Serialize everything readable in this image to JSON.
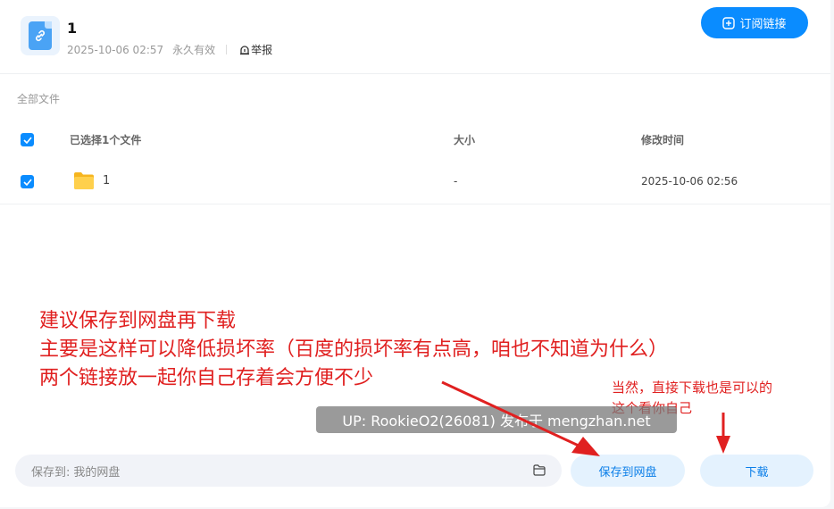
{
  "header": {
    "title": "1",
    "date": "2025-10-06 02:57",
    "validity": "永久有效",
    "report_label": "举报",
    "subscribe_label": "订阅链接"
  },
  "breadcrumb": "全部文件",
  "table": {
    "headers": {
      "name": "已选择1个文件",
      "size": "大小",
      "modified": "修改时间"
    },
    "rows": [
      {
        "name": "1",
        "size": "-",
        "modified": "2025-10-06 02:56",
        "checked": true,
        "icon": "folder-icon"
      }
    ]
  },
  "annotations": {
    "lines": [
      "建议保存到网盘再下载",
      "主要是这样可以降低损坏率（百度的损坏率有点高，咱也不知道为什么）",
      "两个链接放一起你自己存着会方便不少"
    ],
    "side_lines": [
      "当然，直接下载也是可以的",
      "这个看你自己"
    ],
    "color": "#e02020"
  },
  "watermark": "UP: RookieO2(26081) 发布于 mengzhan.net",
  "bottom": {
    "save_prefix": "保存到:",
    "save_location": "我的网盘",
    "save_button": "保存到网盘",
    "download_button": "下载"
  },
  "colors": {
    "accent": "#0a8cff",
    "button_bg": "#e4f2fe",
    "annotation": "#e02020"
  }
}
